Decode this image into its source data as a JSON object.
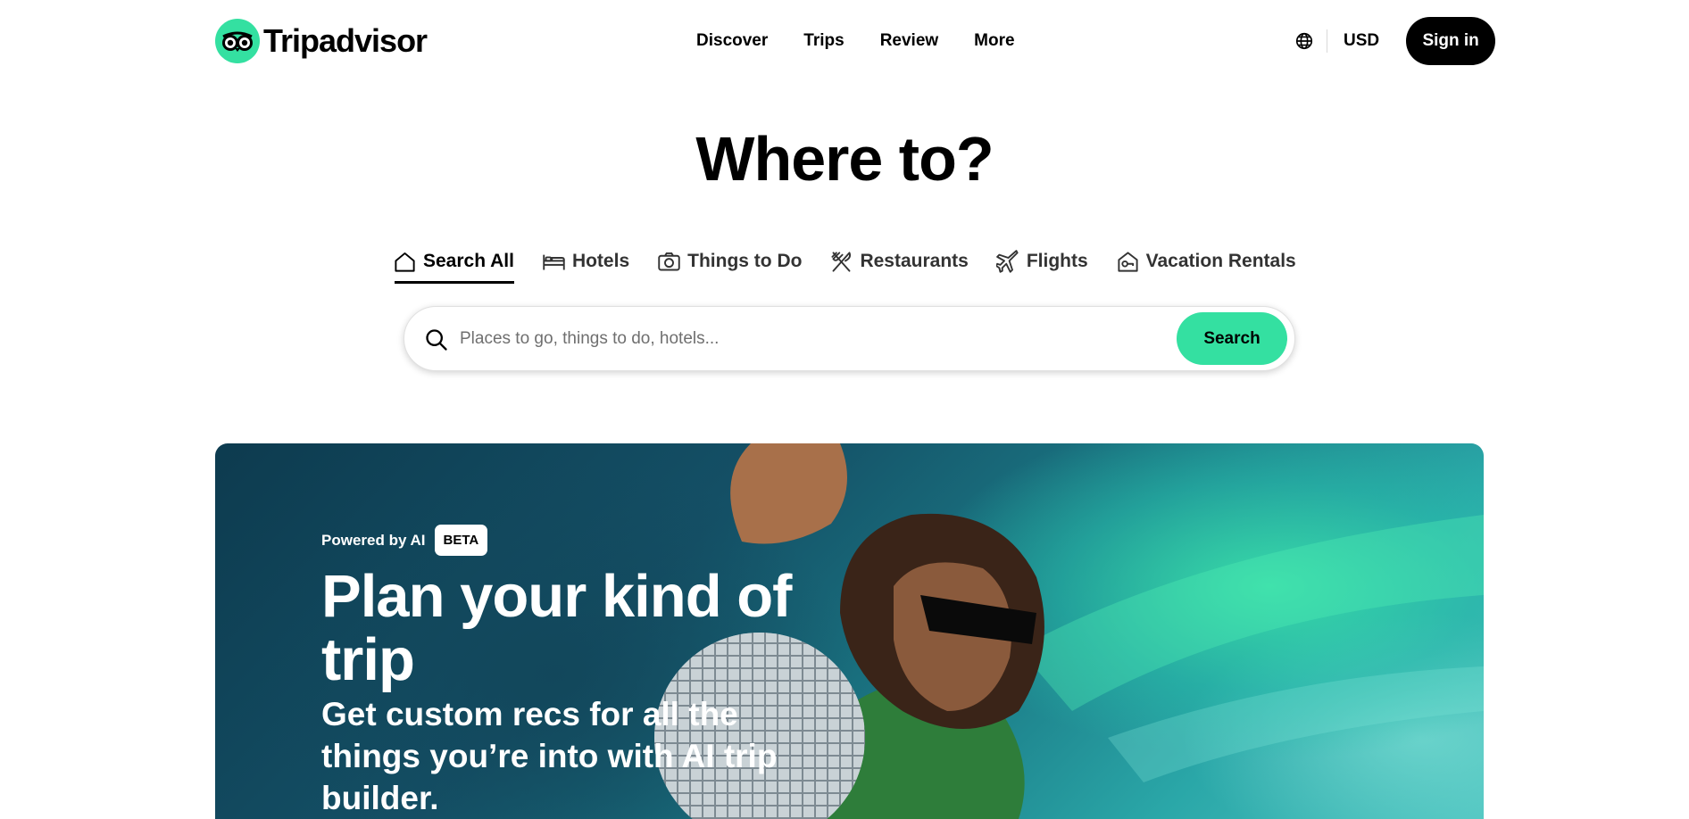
{
  "header": {
    "logo_text": "Tripadvisor",
    "nav": [
      "Discover",
      "Trips",
      "Review",
      "More"
    ],
    "currency": "USD",
    "signin_label": "Sign in"
  },
  "hero": {
    "title": "Where to?"
  },
  "tabs": [
    {
      "label": "Search All",
      "icon": "house-icon",
      "active": true
    },
    {
      "label": "Hotels",
      "icon": "bed-icon",
      "active": false
    },
    {
      "label": "Things to Do",
      "icon": "camera-icon",
      "active": false
    },
    {
      "label": "Restaurants",
      "icon": "fork-knife-icon",
      "active": false
    },
    {
      "label": "Flights",
      "icon": "plane-icon",
      "active": false
    },
    {
      "label": "Vacation Rentals",
      "icon": "house-key-icon",
      "active": false
    }
  ],
  "search": {
    "placeholder": "Places to go, things to do, hotels...",
    "button_label": "Search"
  },
  "banner": {
    "powered_label": "Powered by AI",
    "badge": "BETA",
    "title": "Plan your kind of trip",
    "subtitle": "Get custom recs for all the things you’re into with AI trip builder."
  },
  "colors": {
    "brand_green": "#34e0a1",
    "black": "#000000"
  }
}
